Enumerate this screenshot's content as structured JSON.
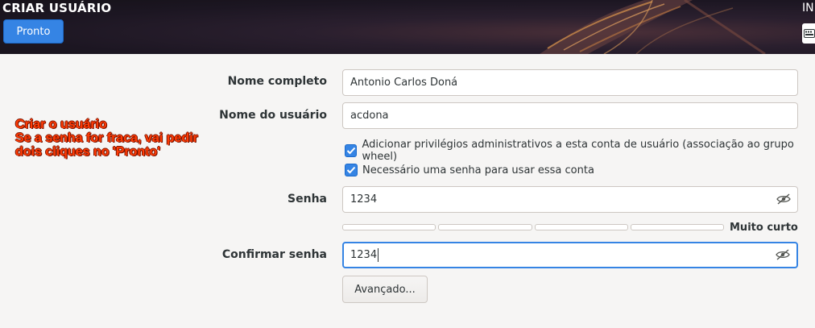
{
  "header": {
    "title": "CRIAR USUÁRIO",
    "done_label": "Pronto",
    "language_code": "IN"
  },
  "form": {
    "fullname": {
      "label": "Nome completo",
      "value": "Antonio Carlos Doná"
    },
    "username": {
      "label": "Nome do usuário",
      "value": "acdona"
    },
    "admin_checkbox": {
      "label": "Adicionar privilégios administrativos a esta conta de usuário (associação ao grupo wheel)",
      "checked": true
    },
    "password_required_checkbox": {
      "label": "Necessário uma senha para usar essa conta",
      "checked": true
    },
    "password": {
      "label": "Senha",
      "value": "1234"
    },
    "strength": {
      "label": "Muito curto",
      "level": 0
    },
    "confirm_password": {
      "label": "Confirmar senha",
      "value": "1234"
    },
    "advanced_label": "Avançado..."
  },
  "annotation": {
    "line1": "Criar o usuário",
    "line2": "Se a senha for fraca, vai pedir",
    "line3": "dois cliques no 'Pronto'"
  },
  "colors": {
    "accent": "#3584e4",
    "annotation": "#ff3b05"
  }
}
